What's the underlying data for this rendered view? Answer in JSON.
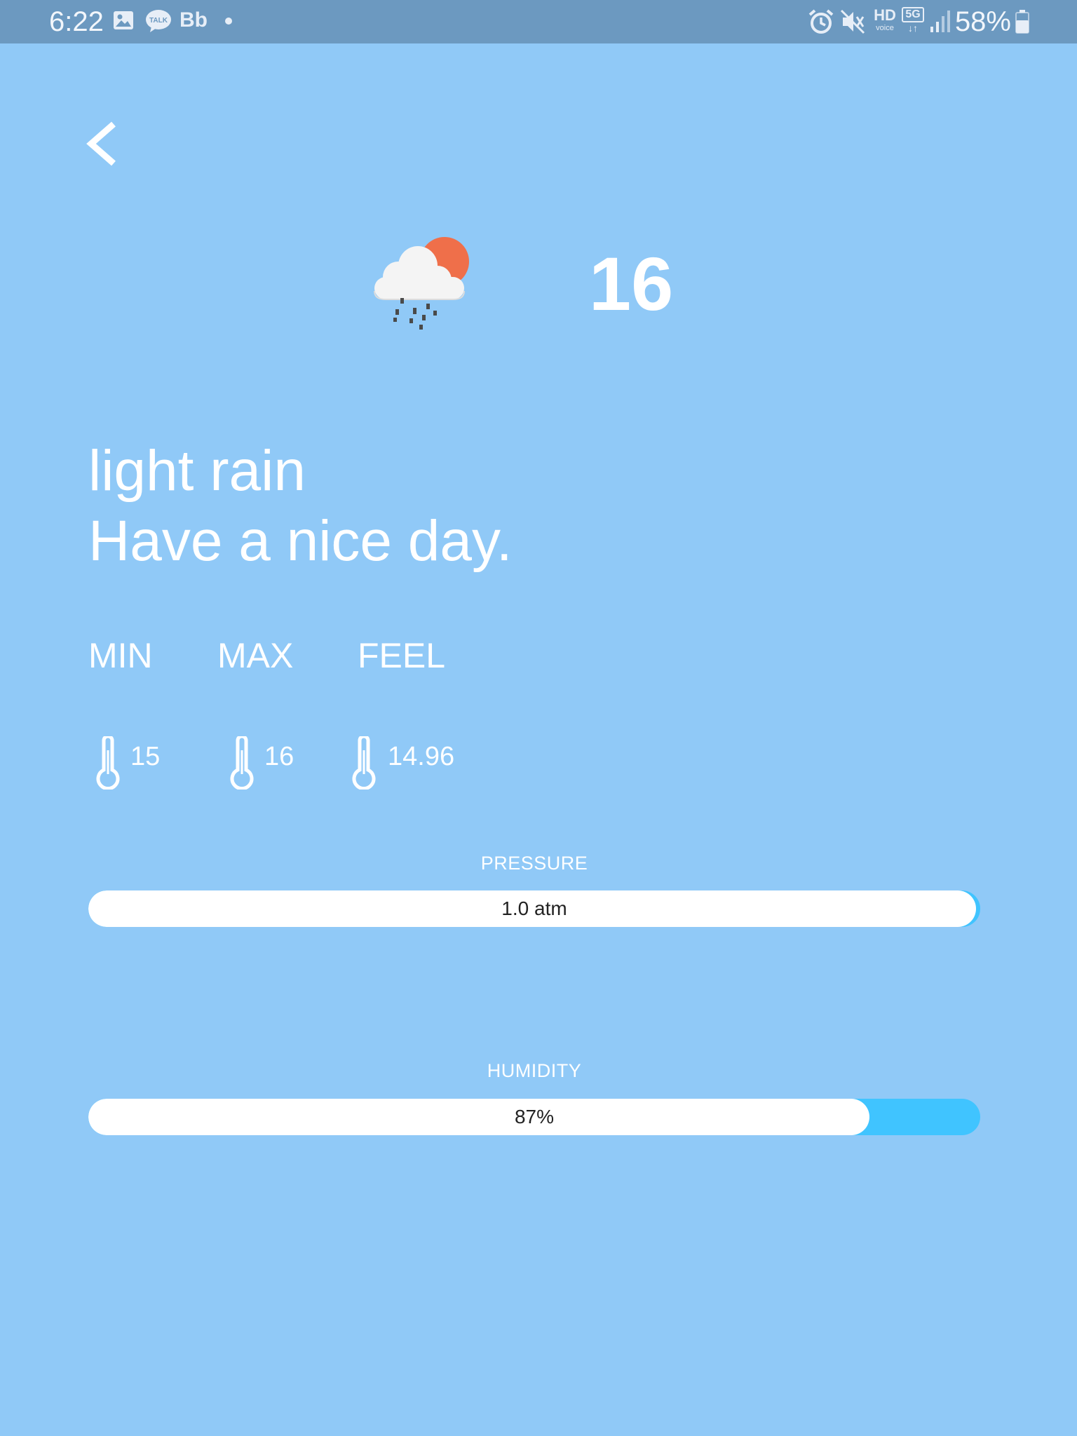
{
  "status_bar": {
    "time": "6:22",
    "talk_label": "TALK",
    "bb_label": "Bb",
    "hd_label": "HD",
    "voice_label": "voice",
    "network_label": "5G",
    "battery_percent": "58%"
  },
  "weather": {
    "icon": "cloud-sun-rain-icon",
    "current_temp": "16",
    "description": "light rain",
    "greeting": "Have a nice day."
  },
  "temperatures": {
    "min_label": "MIN",
    "max_label": "MAX",
    "feel_label": "FEEL",
    "min_value": "15",
    "max_value": "16",
    "feel_value": "14.96"
  },
  "pressure": {
    "label": "PRESSURE",
    "text": "1.0 atm",
    "fill_fraction": 0.995
  },
  "humidity": {
    "label": "HUMIDITY",
    "text": "87%",
    "fill_fraction": 0.876
  },
  "colors": {
    "background": "#90c9f7",
    "status_bar": "#6c99c0",
    "bar_accent": "#40c4ff",
    "sun": "#ef6f4a"
  }
}
